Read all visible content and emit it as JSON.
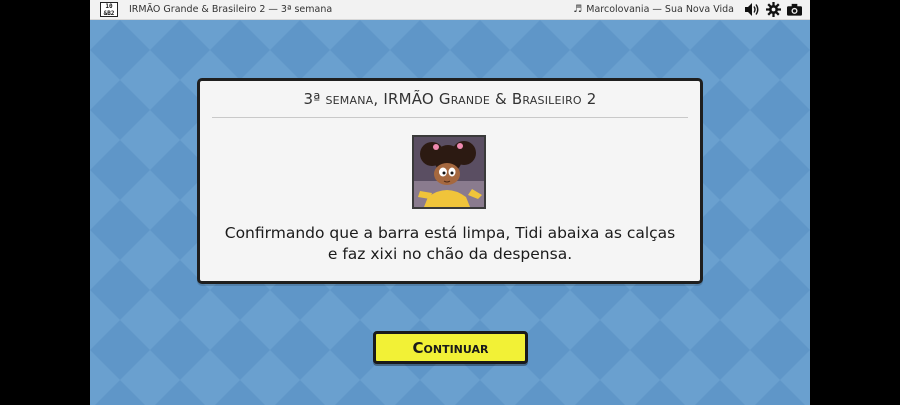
{
  "topbar": {
    "logo_text": "10 &B2",
    "title": "IRMÃO Grande & Brasileiro 2 — 3ª semana",
    "now_playing": "Marcolovania — Sua Nova Vida",
    "icons": [
      "music-note-icon",
      "volume-icon",
      "gear-icon",
      "camera-icon"
    ]
  },
  "dialog": {
    "title": "3ª semana, IRMÃO Grande & Brasileiro 2",
    "story": "Confirmando que a barra está limpa, Tidi abaixa as calças e faz xixi no chão da despensa."
  },
  "continue_button": {
    "label": "Continuar"
  },
  "colors": {
    "background": "#6aa0cf",
    "dialog_bg": "#f5f5f5",
    "button": "#f2f136",
    "border": "#1f1f1f"
  }
}
